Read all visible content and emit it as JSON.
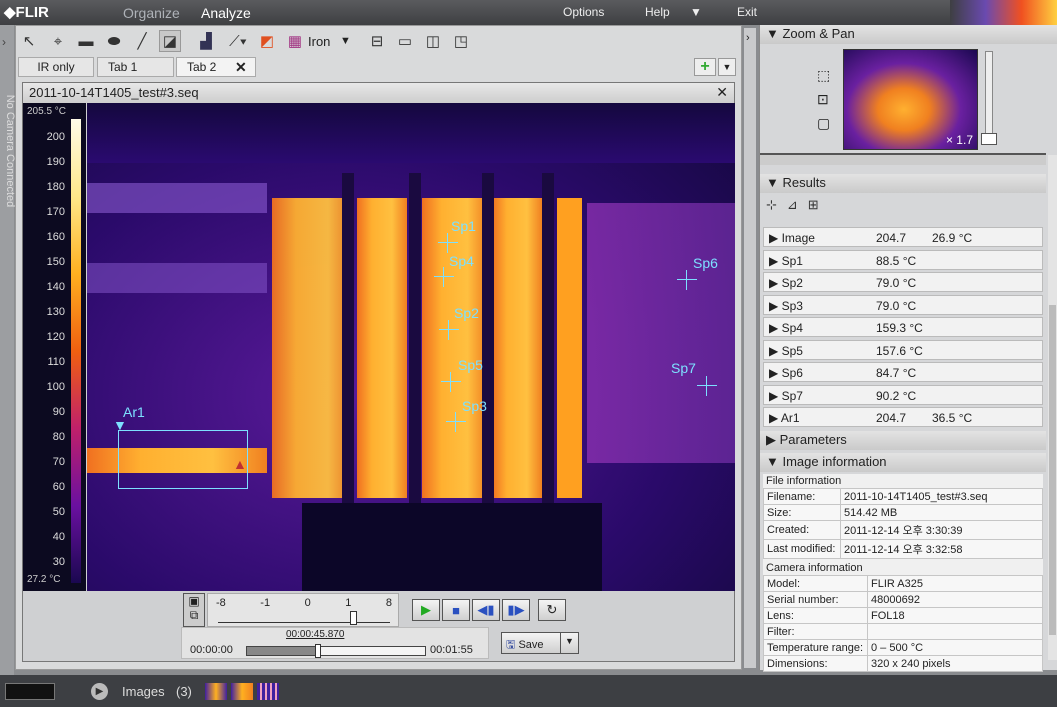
{
  "app": {
    "logo": "FLIR",
    "nav": [
      "Organize",
      "Analyze"
    ],
    "menu": [
      "Options",
      "Help",
      "Exit"
    ],
    "side_status": "No Camera Connected"
  },
  "toolbar": {
    "palette": "Iron"
  },
  "tabs": [
    "IR only",
    "Tab 1",
    "Tab 2"
  ],
  "window": {
    "title": "2011-10-14T1405_test#3.seq"
  },
  "scale": {
    "max": "205.5 °C",
    "min": "27.2 °C",
    "ticks": [
      "200",
      "190",
      "180",
      "170",
      "160",
      "150",
      "140",
      "130",
      "120",
      "110",
      "100",
      "90",
      "80",
      "70",
      "60",
      "50",
      "40",
      "30"
    ]
  },
  "measurements": {
    "spots": [
      "Sp1",
      "Sp2",
      "Sp3",
      "Sp4",
      "Sp5",
      "Sp6",
      "Sp7"
    ],
    "area": "Ar1"
  },
  "playback": {
    "speed_labels": [
      "-8",
      "-1",
      "0",
      "1",
      "8"
    ],
    "current_time": "00:00:45.870",
    "start": "00:00:00",
    "end": "00:01:55",
    "progress": 0.4,
    "save": "Save"
  },
  "right": {
    "zoom_pan": "Zoom & Pan",
    "zoom_level": "× 1.7",
    "results": "Results",
    "parameters": "Parameters",
    "image_information": "Image information",
    "result_rows": [
      {
        "name": "Image",
        "v1": "204.7",
        "v2": "26.9 °C"
      },
      {
        "name": "Sp1",
        "v1": "88.5 °C",
        "v2": ""
      },
      {
        "name": "Sp2",
        "v1": "79.0 °C",
        "v2": ""
      },
      {
        "name": "Sp3",
        "v1": "79.0 °C",
        "v2": ""
      },
      {
        "name": "Sp4",
        "v1": "159.3 °C",
        "v2": ""
      },
      {
        "name": "Sp5",
        "v1": "157.6 °C",
        "v2": ""
      },
      {
        "name": "Sp6",
        "v1": "84.7 °C",
        "v2": ""
      },
      {
        "name": "Sp7",
        "v1": "90.2 °C",
        "v2": ""
      },
      {
        "name": "Ar1",
        "v1": "204.7",
        "v2": "36.5 °C"
      }
    ],
    "file_info_title": "File information",
    "file_info": [
      [
        "Filename:",
        "2011-10-14T1405_test#3.seq"
      ],
      [
        "Size:",
        "514.42 MB"
      ],
      [
        "Created:",
        "2011-12-14 오후 3:30:39"
      ],
      [
        "Last modified:",
        "2011-12-14 오후 3:32:58"
      ]
    ],
    "camera_info_title": "Camera information",
    "camera_info": [
      [
        "Model:",
        "FLIR A325"
      ],
      [
        "Serial number:",
        "48000692"
      ],
      [
        "Lens:",
        "FOL18"
      ],
      [
        "Filter:",
        ""
      ],
      [
        "Temperature range:",
        "0 – 500 °C"
      ],
      [
        "Dimensions:",
        "320 x 240 pixels"
      ]
    ]
  },
  "bottom": {
    "images_label": "Images",
    "images_count": "(3)"
  }
}
